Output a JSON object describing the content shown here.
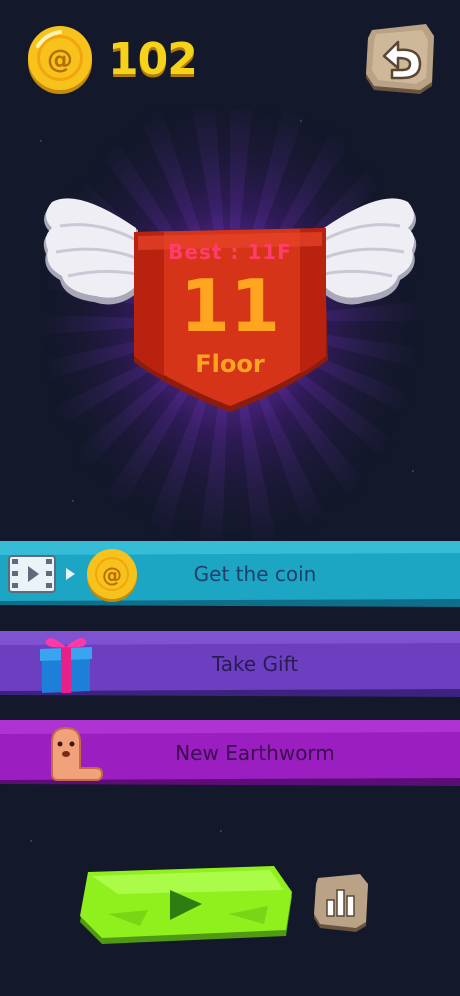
{
  "hud": {
    "coin_count": "102",
    "coin_icon": "gold-coin-icon",
    "back_icon": "undo-arrow-icon"
  },
  "result": {
    "best_label": "Best : 11F",
    "floor_number": "11",
    "floor_label": "Floor"
  },
  "options": {
    "coin": {
      "label": "Get the coin",
      "icons": [
        "video-ad-icon",
        "arrow-right-icon",
        "gold-coin-icon"
      ]
    },
    "gift": {
      "label": "Take Gift",
      "icon": "gift-box-icon"
    },
    "worm": {
      "label": "New Earthworm",
      "icon": "earthworm-icon"
    }
  },
  "controls": {
    "play_icon": "play-icon",
    "rank_icon": "leaderboard-icon"
  },
  "colors": {
    "background": "#13182a",
    "coin_bar": "#1ca6c4",
    "gift_bar": "#6b3fc0",
    "worm_bar": "#9a1ec0",
    "play_button": "#8ff01d",
    "badge": "#d63418",
    "accent_gold": "#f7d21b"
  }
}
